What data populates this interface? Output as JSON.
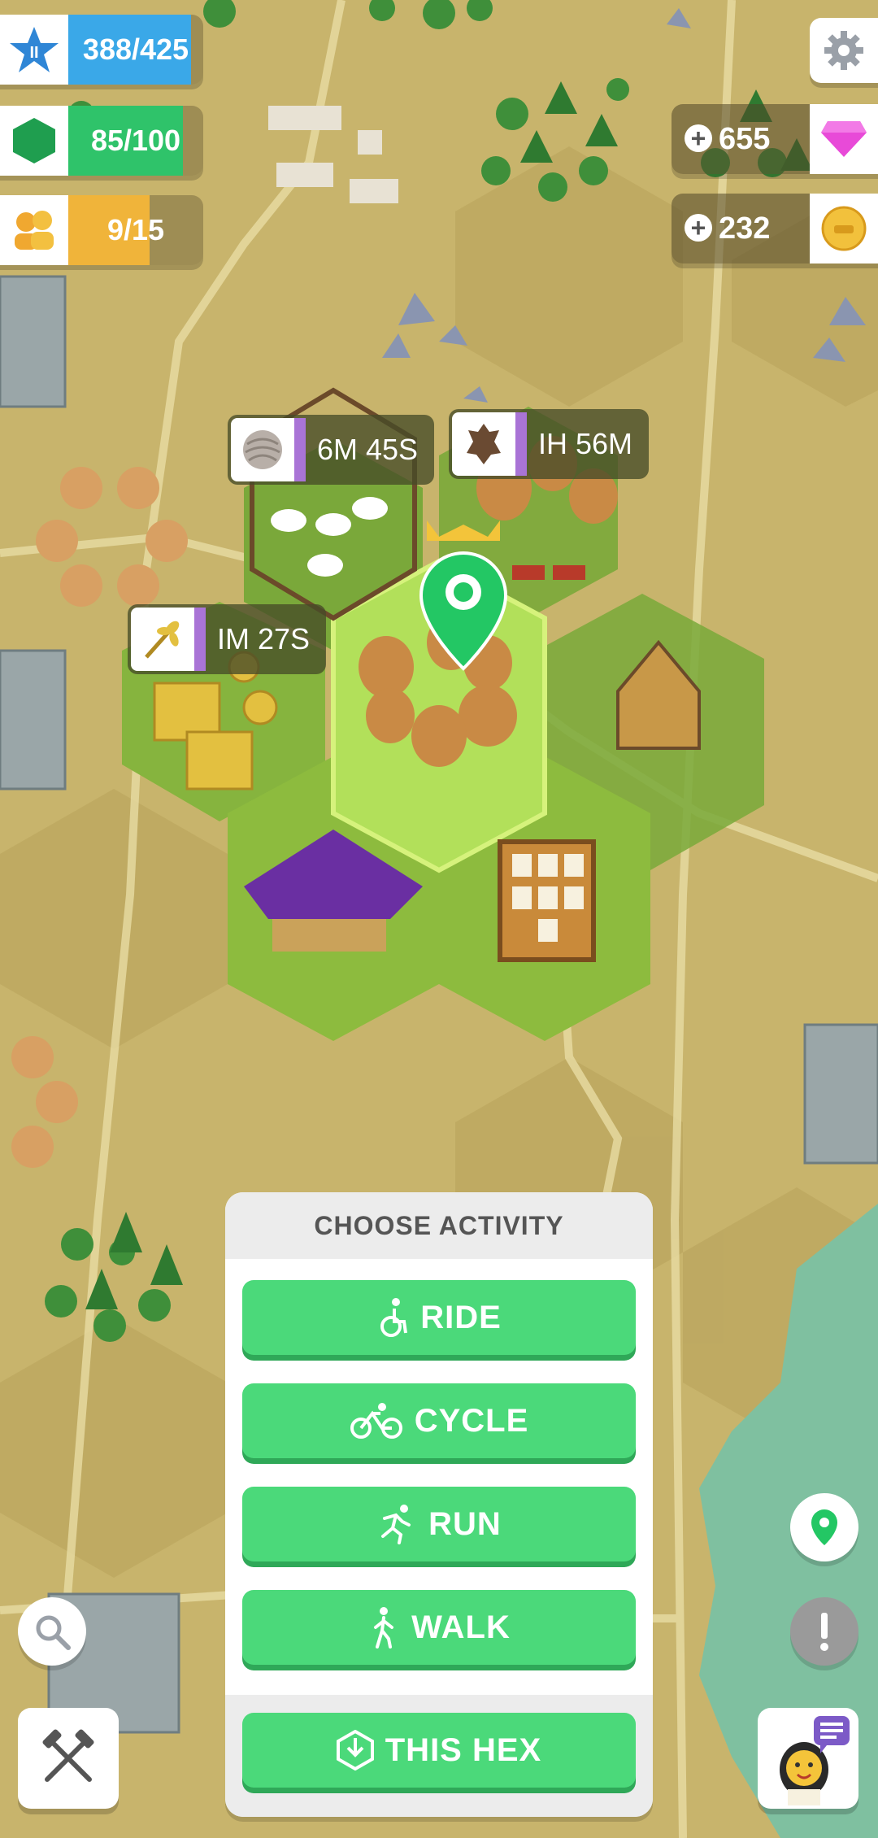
{
  "stats": {
    "level": {
      "value": "388/425",
      "level_number": "II",
      "fill_fraction": 0.91,
      "color": "#3aa8e8",
      "icon": "star-icon"
    },
    "resources": {
      "value": "85/100",
      "fill_fraction": 0.85,
      "color": "#2fc36a",
      "icon": "hexagon-icon"
    },
    "population": {
      "value": "9/15",
      "fill_fraction": 0.6,
      "color": "#f0b43a",
      "icon": "people-icon"
    }
  },
  "currency": {
    "gems": {
      "amount": "655",
      "icon": "gem-icon",
      "color": "#e84ad8"
    },
    "coins": {
      "amount": "232",
      "icon": "coin-icon",
      "color": "#f2c13c"
    }
  },
  "timers": [
    {
      "label": "6M 45S",
      "icon": "wool-icon"
    },
    {
      "label": "IH 56M",
      "icon": "hide-icon"
    },
    {
      "label": "IM 27S",
      "icon": "wheat-icon"
    }
  ],
  "activity": {
    "title": "CHOOSE ACTIVITY",
    "buttons": [
      {
        "label": "RIDE",
        "icon": "wheelchair-icon"
      },
      {
        "label": "CYCLE",
        "icon": "bicycle-icon"
      },
      {
        "label": "RUN",
        "icon": "runner-icon"
      },
      {
        "label": "WALK",
        "icon": "walker-icon"
      }
    ],
    "this_hex": {
      "label": "THIS HEX",
      "icon": "hex-download-icon"
    }
  },
  "colors": {
    "accent_green": "#4bd97a",
    "timer_purple": "#a974d6",
    "map_sand": "#c9b46b",
    "map_green": "#8dbb3e"
  }
}
